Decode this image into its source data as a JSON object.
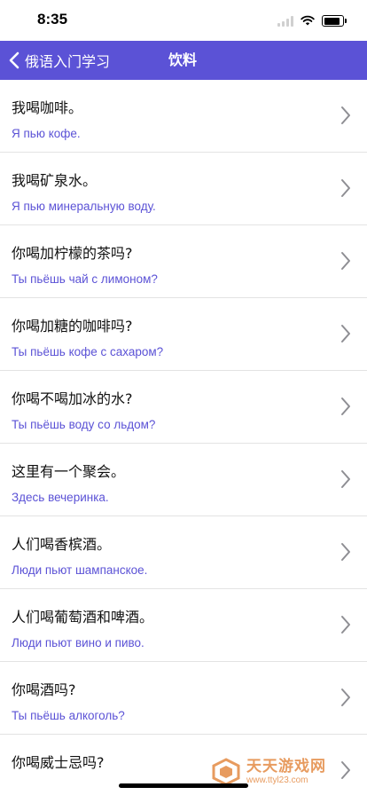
{
  "status_bar": {
    "time": "8:35"
  },
  "nav": {
    "back_label": "俄语入门学习",
    "title": "饮料"
  },
  "phrases": [
    {
      "cn": "我喝咖啡。",
      "ru": "Я пью кофе."
    },
    {
      "cn": "我喝矿泉水。",
      "ru": "Я пью минеральную воду."
    },
    {
      "cn": "你喝加柠檬的茶吗?",
      "ru": "Ты пьёшь чай с лимоном?"
    },
    {
      "cn": "你喝加糖的咖啡吗?",
      "ru": "Ты пьёшь кофе с сахаром?"
    },
    {
      "cn": "你喝不喝加冰的水?",
      "ru": "Ты пьёшь воду со льдом?"
    },
    {
      "cn": "这里有一个聚会。",
      "ru": "Здесь вечеринка."
    },
    {
      "cn": "人们喝香槟酒。",
      "ru": "Люди пьют шампанское."
    },
    {
      "cn": "人们喝葡萄酒和啤酒。",
      "ru": "Люди пьют вино и пиво."
    },
    {
      "cn": "你喝酒吗?",
      "ru": "Ты пьёшь алкоголь?"
    },
    {
      "cn": "你喝威士忌吗?",
      "ru": ""
    }
  ],
  "watermark": {
    "title": "天天游戏网",
    "url": "www.ttyl23.com"
  },
  "colors": {
    "nav_background": "#5b52d6",
    "translation_text": "#5b52d6",
    "chevron": "#8e8e93"
  }
}
